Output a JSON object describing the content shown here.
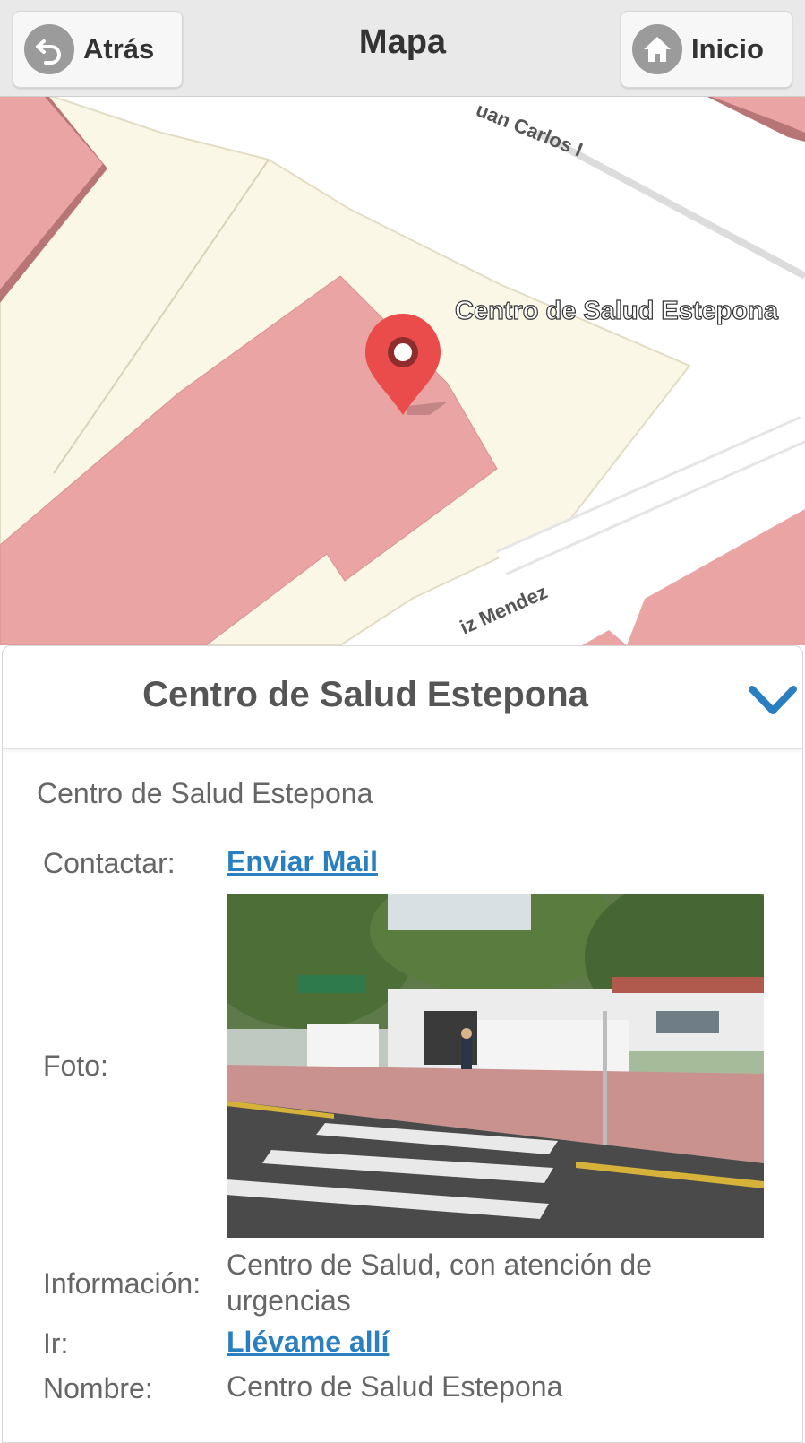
{
  "header": {
    "title": "Mapa",
    "back_label": "Atrás",
    "home_label": "Inicio"
  },
  "map": {
    "street_1": "uan Carlos I",
    "street_2": "iz Mendez",
    "poi_label": "Centro de Salud Estepona"
  },
  "panel": {
    "title": "Centro de Salud Estepona",
    "subtitle": "Centro de Salud Estepona",
    "rows": {
      "contact_label": "Contactar:",
      "contact_link": "Enviar Mail",
      "photo_label": "Foto:",
      "info_label": "Información:",
      "info_value": "Centro de Salud, con atención de urgencias",
      "go_label": "Ir:",
      "go_link": "Llévame allí",
      "name_label": "Nombre:",
      "name_value": "Centro de Salud Estepona"
    }
  },
  "colors": {
    "accent": "#2a7fc1",
    "building": "#eba4a4",
    "area": "#fbf7e6",
    "marker": "#ea4c4c"
  }
}
